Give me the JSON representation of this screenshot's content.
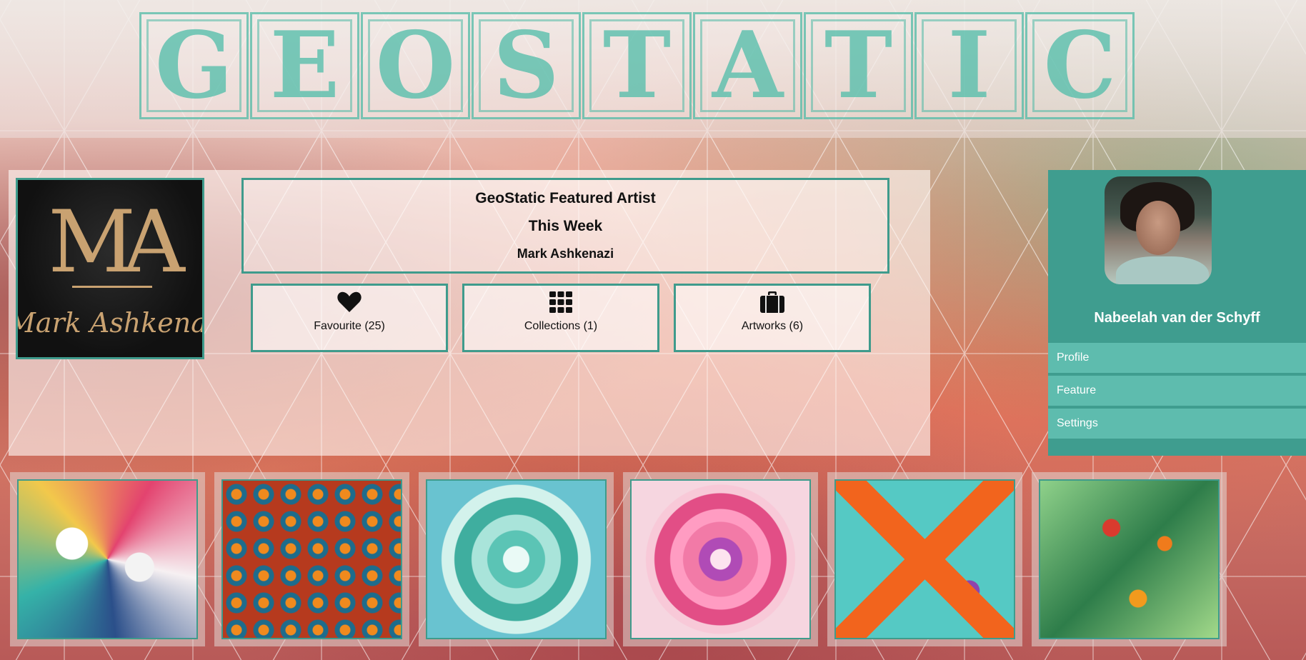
{
  "brand": {
    "logo_letters": [
      "G",
      "E",
      "O",
      "S",
      "T",
      "A",
      "T",
      "I",
      "C"
    ],
    "accent_color": "#3f9b8c",
    "logo_color": "#54beaa"
  },
  "featured": {
    "title": "GeoStatic Featured Artist",
    "period": "This Week",
    "artist_name": "Mark Ashkenazi",
    "artist_logo_text": "Mark Ashkenazi A",
    "artist_monogram": "MA",
    "stats": [
      {
        "icon": "heart-icon",
        "label": "Favourite (25)"
      },
      {
        "icon": "grid-icon",
        "label": "Collections (1)"
      },
      {
        "icon": "briefcase-icon",
        "label": "Artworks (6)"
      }
    ]
  },
  "user": {
    "name": "Nabeelah van der Schyff",
    "menu": [
      {
        "label": "Profile"
      },
      {
        "label": "Feature"
      },
      {
        "label": "Settings"
      }
    ],
    "panel_color": "#3f9d8f",
    "menu_color": "#5ebcae"
  },
  "gallery": {
    "items": [
      {
        "name": "artwork-floral-geometric"
      },
      {
        "name": "artwork-mosaic-orange"
      },
      {
        "name": "artwork-mandala-teal"
      },
      {
        "name": "artwork-mandala-pink"
      },
      {
        "name": "artwork-tropical-diamond"
      },
      {
        "name": "artwork-tropical-fruit"
      }
    ]
  }
}
